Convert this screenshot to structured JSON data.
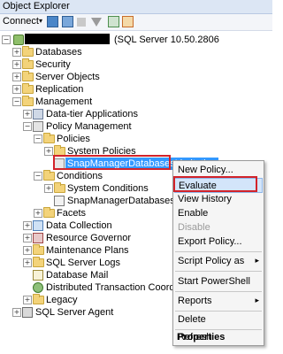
{
  "window": {
    "title": "Object Explorer"
  },
  "toolbar": {
    "connect_label": "Connect",
    "caret": "▾"
  },
  "tree": {
    "server_label": "(SQL Server 10.50.2806",
    "databases": "Databases",
    "security": "Security",
    "server_objects": "Server Objects",
    "replication": "Replication",
    "management": "Management",
    "data_tier": "Data-tier Applications",
    "policy_management": "Policy Management",
    "policies": "Policies",
    "system_policies": "System Policies",
    "snap_policy": "SnapManagerDatabasesLimitation",
    "conditions": "Conditions",
    "system_conditions": "System Conditions",
    "snap_condition": "SnapManagerDatabases",
    "facets": "Facets",
    "data_collection": "Data Collection",
    "resource_governor": "Resource Governor",
    "maintenance_plans": "Maintenance Plans",
    "sql_server_logs": "SQL Server Logs",
    "database_mail": "Database Mail",
    "dtc": "Distributed Transaction Coord",
    "legacy": "Legacy",
    "sql_server_agent": "SQL Server Agent",
    "plus": "+",
    "minus": "−"
  },
  "context_menu": {
    "new_policy": "New Policy...",
    "evaluate": "Evaluate",
    "view_history": "View History",
    "enable": "Enable",
    "disable": "Disable",
    "export_policy": "Export Policy...",
    "script_policy_as": "Script Policy as",
    "start_powershell": "Start PowerShell",
    "reports": "Reports",
    "delete": "Delete",
    "refresh": "Refresh",
    "properties": "Properties",
    "submenu_arrow": "▸"
  },
  "colors": {
    "selection": "#3399ff",
    "annotation_red": "#d2232a",
    "folder": "#f3d37a"
  }
}
